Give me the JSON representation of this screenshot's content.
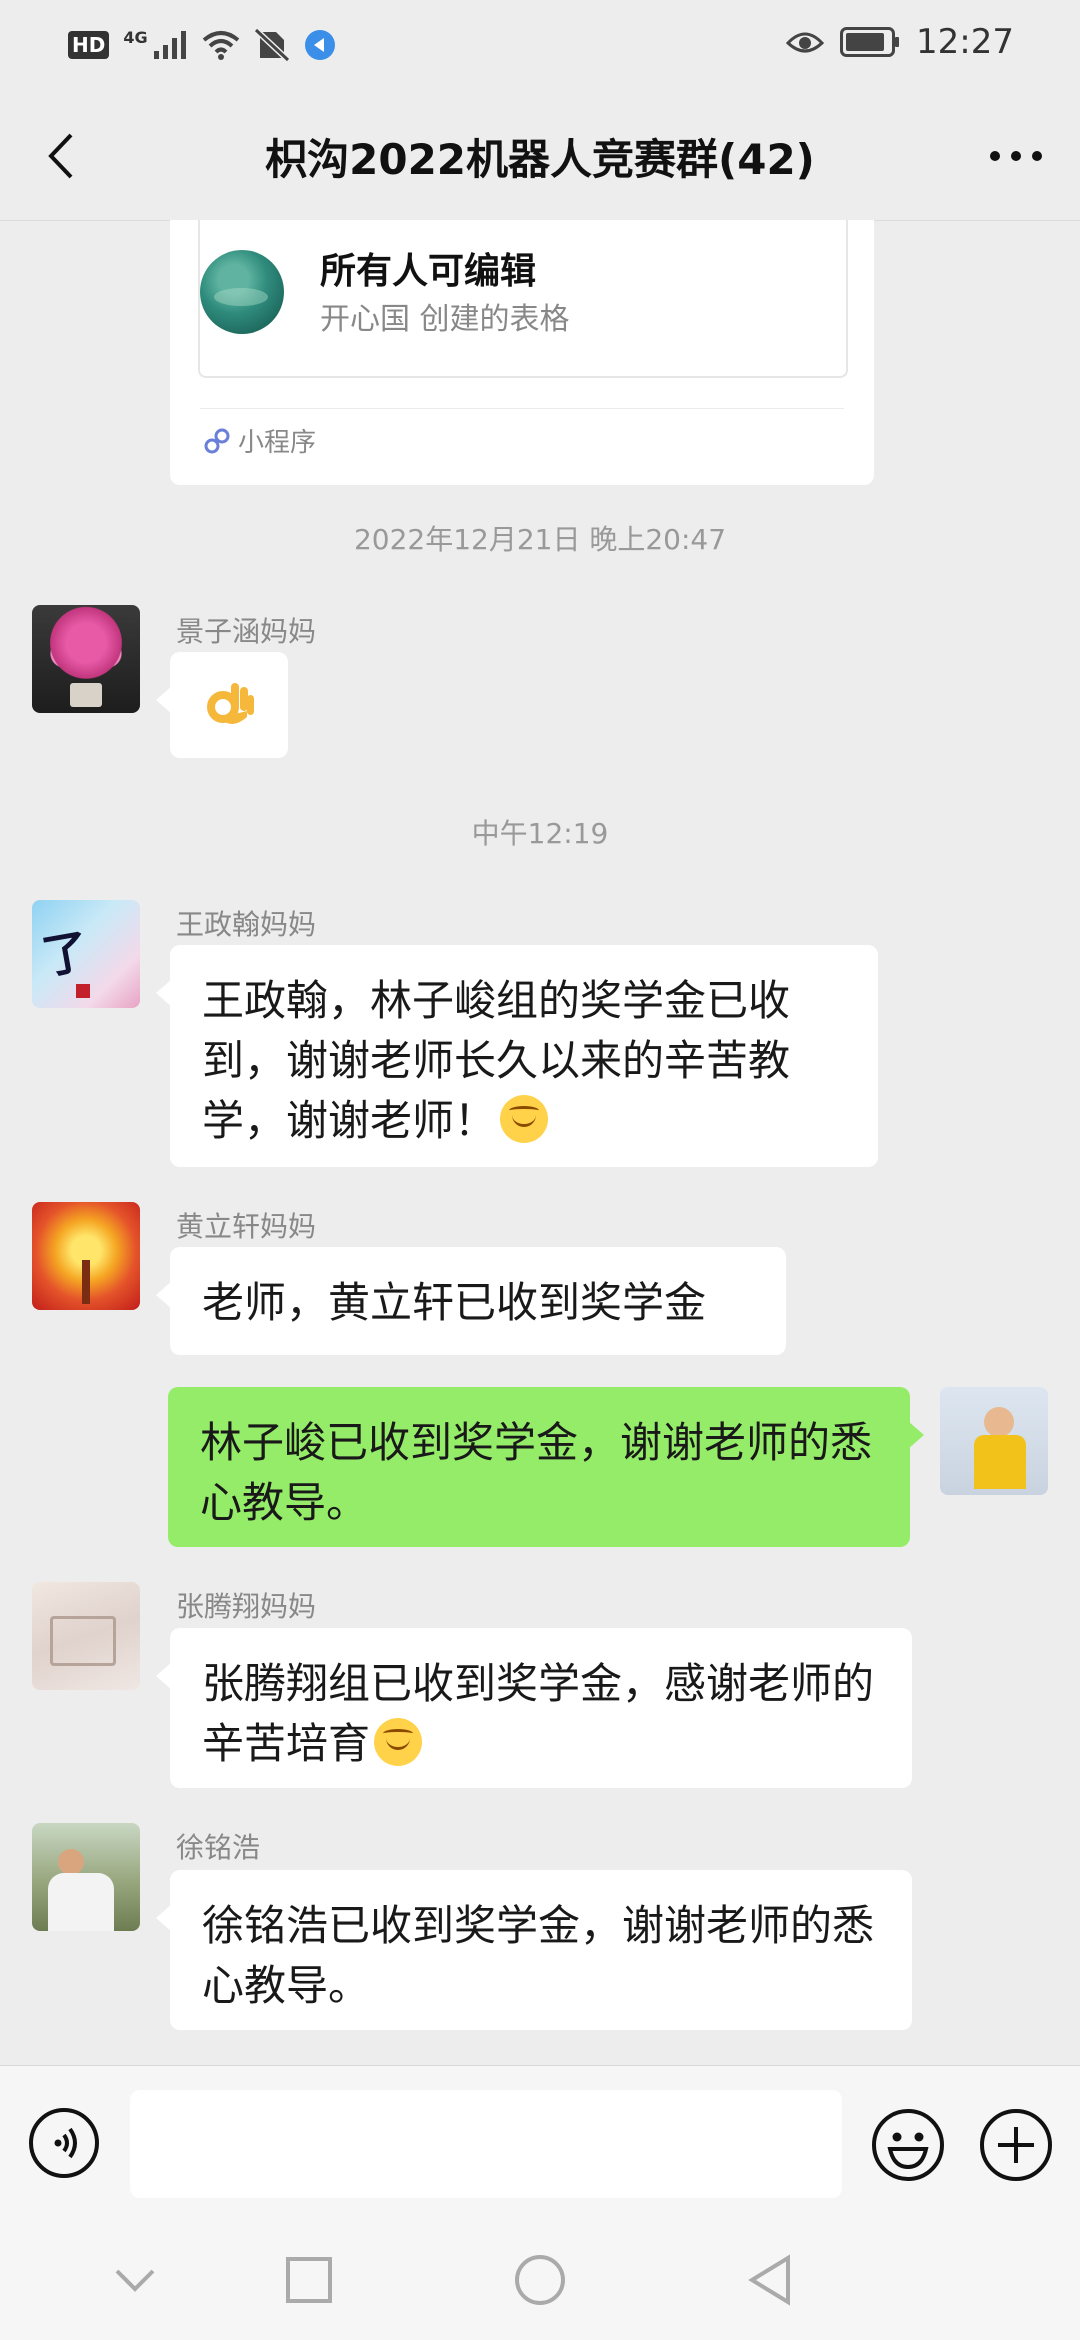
{
  "status_bar": {
    "network_hd": "HD",
    "network_type": "4G",
    "time": "12:27"
  },
  "header": {
    "title": "枳沟2022机器人竞赛群(42)"
  },
  "shared_card": {
    "title": "所有人可编辑",
    "subtitle": "开心国 创建的表格",
    "footer_label": "小程序"
  },
  "timestamps": [
    "2022年12月21日 晚上20:47",
    "中午12:19"
  ],
  "messages": [
    {
      "sender": "景子涵妈妈",
      "text": "",
      "sticker": "ok-hand-emoji",
      "mine": false
    },
    {
      "sender": "王政翰妈妈",
      "text": "王政翰，林子峻组的奖学金已收到，谢谢老师长久以来的辛苦教学，谢谢老师！",
      "emoji": "smiling-face-emoji",
      "mine": false
    },
    {
      "sender": "黄立轩妈妈",
      "text": "老师，黄立轩已收到奖学金",
      "mine": false
    },
    {
      "sender": "",
      "text": "林子峻已收到奖学金，谢谢老师的悉心教导。",
      "mine": true
    },
    {
      "sender": "张腾翔妈妈",
      "text": "张腾翔组已收到奖学金，感谢老师的辛苦培育",
      "emoji": "smiling-face-emoji",
      "mine": false
    },
    {
      "sender": "徐铭浩",
      "text": "徐铭浩已收到奖学金，谢谢老师的悉心教导。",
      "mine": false
    }
  ],
  "input_bar": {
    "message_value": ""
  },
  "colors": {
    "background": "#ededed",
    "my_bubble": "#95ec69",
    "other_bubble": "#ffffff",
    "header_title": "#111111"
  }
}
